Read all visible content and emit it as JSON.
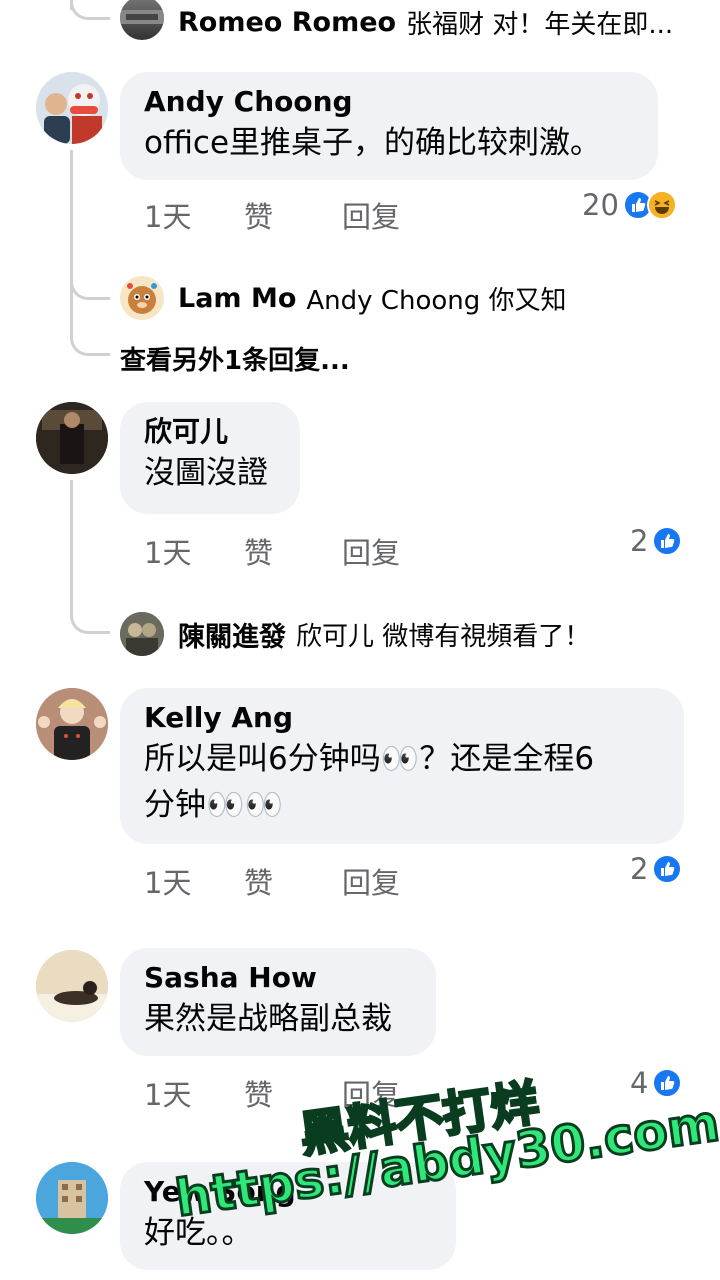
{
  "top_reply": {
    "name": "Romeo Romeo",
    "text": "张福财 对！年关在即..."
  },
  "comments": [
    {
      "name": "Andy Choong",
      "lines": [
        "office里推桌子，的确比较刺激。"
      ],
      "time": "1天",
      "like": "赞",
      "reply": "回复",
      "reaction_count": "20"
    },
    {
      "name": "欣可儿",
      "lines": [
        "沒圖沒證"
      ],
      "time": "1天",
      "like": "赞",
      "reply": "回复",
      "reaction_count": "2"
    },
    {
      "name": "Kelly Ang",
      "lines": [
        "所以是叫6分钟吗👀？还是全程6",
        "分钟👀👀"
      ],
      "time": "1天",
      "like": "赞",
      "reply": "回复",
      "reaction_count": "2"
    },
    {
      "name": "Sasha How",
      "lines": [
        "果然是战略副总裁"
      ],
      "time": "1天",
      "like": "赞",
      "reply": "回复",
      "reaction_count": "4"
    },
    {
      "name": "Yew Song",
      "lines": [
        "好吃。。"
      ]
    }
  ],
  "replies": {
    "lam_mo": {
      "name": "Lam Mo",
      "text": "Andy Choong 你又知"
    },
    "view_more": "查看另外1条回复...",
    "chen": {
      "name": "陳關進發",
      "text": "欣可儿 微博有視頻看了！"
    }
  },
  "watermark": {
    "line1": "黑料不打烊",
    "line2": "https://abdy30.com"
  },
  "colors": {
    "like_blue": "#1877f2",
    "bubble_bg": "#f0f2f5",
    "thread_line": "#ced0d4",
    "watermark_green": "#2ee87a"
  }
}
